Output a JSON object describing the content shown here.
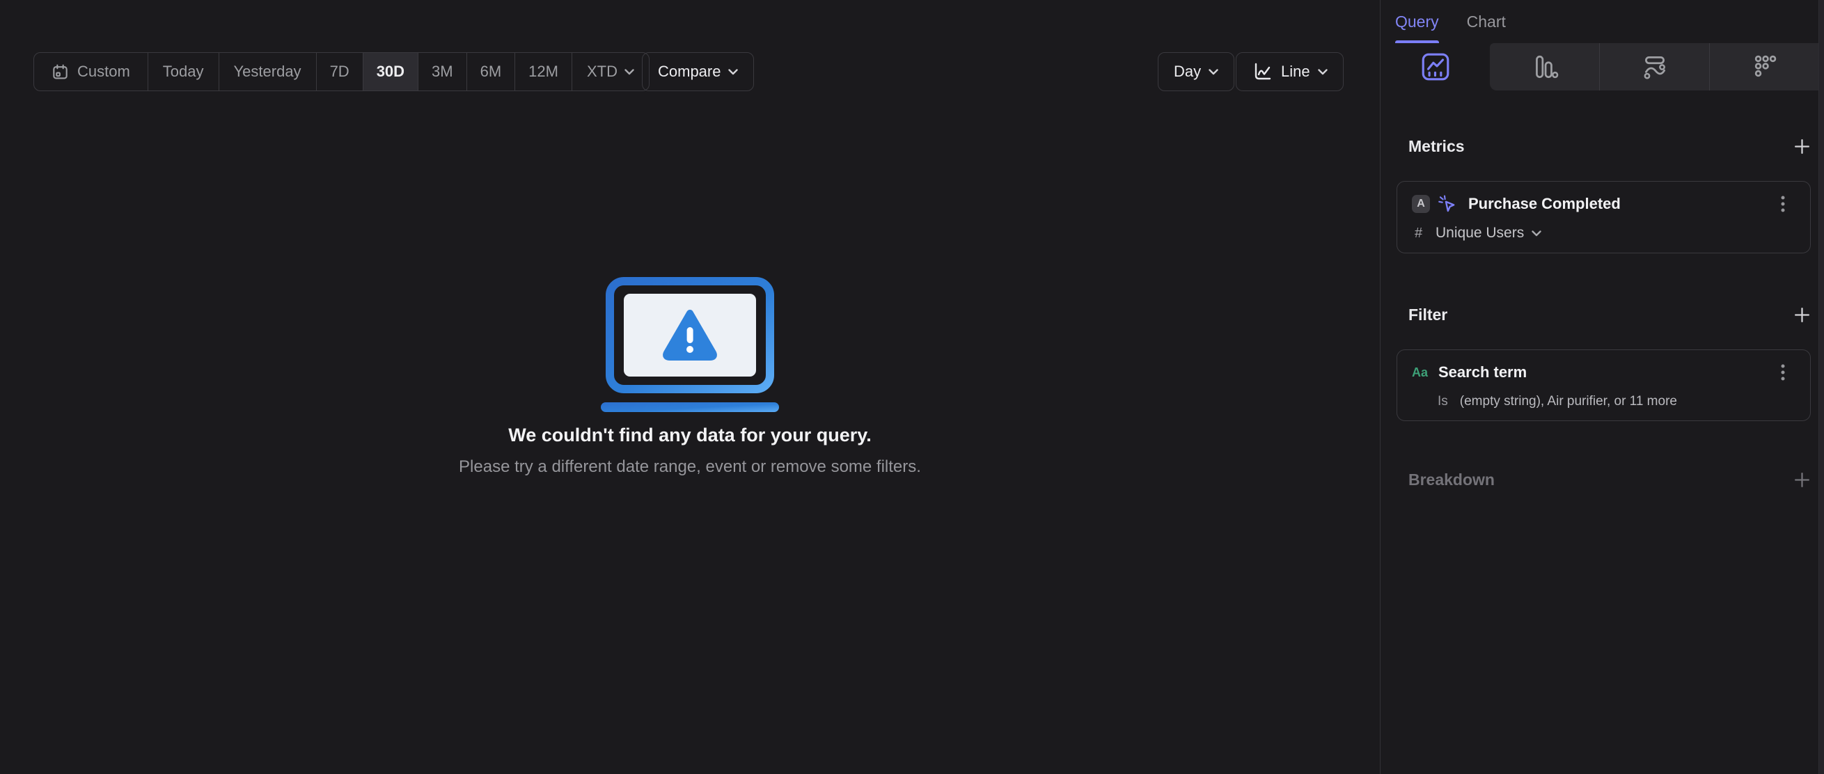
{
  "colors": {
    "background": "#1b1a1d",
    "accent_purple": "#7b7ef8",
    "accent_green": "#3da077",
    "graphic_blue_dark": "#2c72d0",
    "graphic_blue_light": "#5babf4",
    "selected_segment_bg": "#2d2c31"
  },
  "toolbar": {
    "date_presets": [
      "Custom",
      "Today",
      "Yesterday",
      "7D",
      "30D",
      "3M",
      "6M",
      "12M",
      "XTD"
    ],
    "selected_preset": "30D",
    "compare_label": "Compare",
    "granularity_label": "Day",
    "chart_type_label": "Line"
  },
  "empty_state": {
    "title": "We couldn't find any data for your query.",
    "subtitle": "Please try a different date range, event or remove some filters."
  },
  "sidebar": {
    "tabs": [
      {
        "label": "Query",
        "active": true
      },
      {
        "label": "Chart",
        "active": false
      }
    ],
    "view_tabs": [
      {
        "icon": "insights-line-icon",
        "active": true
      },
      {
        "icon": "funnel-bars-icon",
        "active": false
      },
      {
        "icon": "flows-icon",
        "active": false
      },
      {
        "icon": "retention-dots-icon",
        "active": false
      }
    ],
    "metrics": {
      "heading": "Metrics",
      "items": [
        {
          "letter": "A",
          "event": "Purchase Completed",
          "aggregation_symbol": "#",
          "aggregation": "Unique Users"
        }
      ]
    },
    "filter": {
      "heading": "Filter",
      "items": [
        {
          "type_badge": "Aa",
          "property": "Search term",
          "operator": "Is",
          "value": "(empty string), Air purifier, or 11 more"
        }
      ]
    },
    "breakdown": {
      "heading": "Breakdown"
    }
  }
}
